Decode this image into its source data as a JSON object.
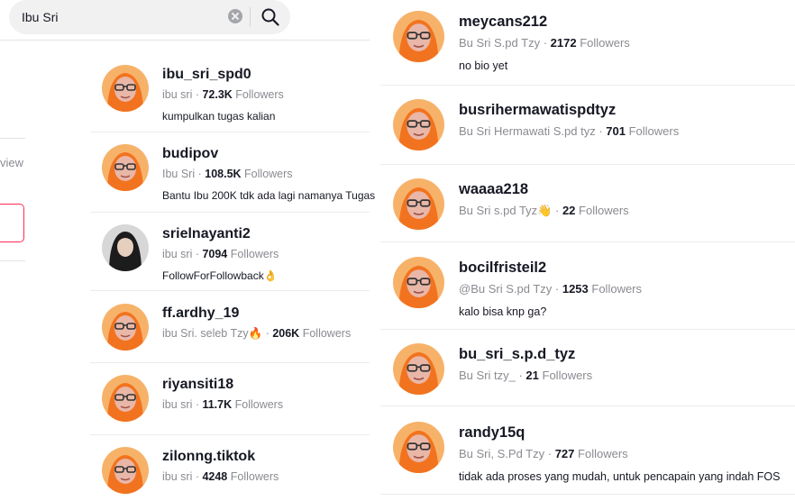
{
  "search": {
    "query": "Ibu Sri"
  },
  "left": {
    "partial_text": "view"
  },
  "users_left": [
    {
      "username": "ibu_sri_spd0",
      "nickname": "ibu sri",
      "followers": "72.3K",
      "followers_label": "Followers",
      "bio": "kumpulkan tugas kalian"
    },
    {
      "username": "budipov",
      "nickname": "Ibu Sri",
      "followers": "108.5K",
      "followers_label": "Followers",
      "bio": "Bantu Ibu 200K tdk ada lagi namanya Tugas"
    },
    {
      "username": "srielnayanti2",
      "nickname": "ibu sri",
      "followers": "7094",
      "followers_label": "Followers",
      "bio": "FollowForFollowback👌"
    },
    {
      "username": "ff.ardhy_19",
      "nickname": "ibu Sri. seleb Tzy🔥",
      "followers": "206K",
      "followers_label": "Followers",
      "bio": ""
    },
    {
      "username": "riyansiti18",
      "nickname": "ibu sri",
      "followers": "11.7K",
      "followers_label": "Followers",
      "bio": ""
    },
    {
      "username": "zilonng.tiktok",
      "nickname": "ibu sri",
      "followers": "4248",
      "followers_label": "Followers",
      "bio": ""
    }
  ],
  "users_right": [
    {
      "username": "meycans212",
      "nickname": "Bu Sri S.pd Tzy",
      "followers": "2172",
      "followers_label": "Followers",
      "bio": "no bio yet"
    },
    {
      "username": "busrihermawatispdtyz",
      "nickname": "Bu Sri Hermawati S.pd tyz",
      "followers": "701",
      "followers_label": "Followers",
      "bio": ""
    },
    {
      "username": "waaaa218",
      "nickname": "Bu Sri s.pd Tyz👋",
      "followers": "22",
      "followers_label": "Followers",
      "bio": ""
    },
    {
      "username": "bocilfristeil2",
      "nickname": "@Bu Sri S.pd Tzy",
      "followers": "1253",
      "followers_label": "Followers",
      "bio": "kalo bisa knp ga?"
    },
    {
      "username": "bu_sri_s.p.d_tyz",
      "nickname": "Bu Sri tzy_",
      "followers": "21",
      "followers_label": "Followers",
      "bio": ""
    },
    {
      "username": "randy15q",
      "nickname": "Bu Sri, S.Pd Tzy",
      "followers": "727",
      "followers_label": "Followers",
      "bio": "tidak ada proses yang mudah, untuk pencapain yang indah FOS"
    }
  ],
  "icons": {
    "search": "search-icon",
    "clear": "clear-icon",
    "avatar": "avatar"
  },
  "colors": {
    "accent": "#fe2c55",
    "secondary_text": "#8a8b91",
    "avatar_bg": "#f7b26a",
    "hijab": "#f2731f",
    "face": "#e9b7a8"
  }
}
